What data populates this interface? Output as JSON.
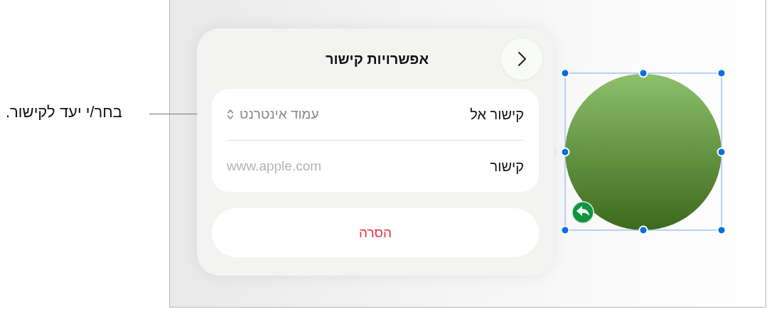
{
  "callout": {
    "text": "בחר/י יעד לקישור."
  },
  "popover": {
    "title": "אפשרויות קישור",
    "rows": [
      {
        "kind": "select",
        "label": "קישור אל",
        "value": "עמוד אינטרנט"
      },
      {
        "kind": "field",
        "label": "קישור",
        "placeholder": "www.apple.com"
      }
    ],
    "delete_button": "הסרה"
  },
  "shape": {
    "selected": true
  }
}
